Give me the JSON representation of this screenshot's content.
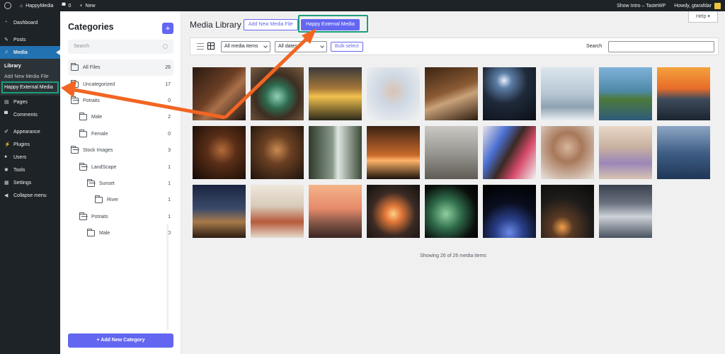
{
  "adminbar": {
    "site_name": "HappyMedia",
    "comments_count": "0",
    "new_label": "New",
    "show_intro": "Show Intro – TasteWP",
    "howdy": "Howdy, gtarafdar"
  },
  "adminmenu": {
    "items": [
      {
        "label": "Dashboard",
        "icon": "dashboard-icon"
      },
      {
        "label": "Posts",
        "icon": "pin-icon"
      },
      {
        "label": "Media",
        "icon": "media-icon"
      },
      {
        "label": "Pages",
        "icon": "page-icon"
      },
      {
        "label": "Comments",
        "icon": "comment-icon"
      },
      {
        "label": "Appearance",
        "icon": "brush-icon"
      },
      {
        "label": "Plugins",
        "icon": "plug-icon"
      },
      {
        "label": "Users",
        "icon": "user-icon"
      },
      {
        "label": "Tools",
        "icon": "wrench-icon"
      },
      {
        "label": "Settings",
        "icon": "settings-icon"
      },
      {
        "label": "Collapse menu",
        "icon": "collapse-icon"
      }
    ],
    "media_submenu": [
      "Library",
      "Add New Media File",
      "Happy External Media"
    ]
  },
  "categories": {
    "title": "Categories",
    "add_symbol": "+",
    "search_placeholder": "Search",
    "items": [
      {
        "label": "All Files",
        "count": "26"
      },
      {
        "label": "Uncategorized",
        "count": "17"
      },
      {
        "label": "Potraits",
        "count": "0"
      },
      {
        "label": "Male",
        "count": "2"
      },
      {
        "label": "Female",
        "count": "0"
      },
      {
        "label": "Stock Images",
        "count": "3"
      },
      {
        "label": "LandScape",
        "count": "1"
      },
      {
        "label": "Sunset",
        "count": "1"
      },
      {
        "label": "River",
        "count": "1"
      },
      {
        "label": "Potraits",
        "count": "1"
      },
      {
        "label": "Male",
        "count": "0"
      }
    ],
    "new_category_button": "+ Add New Category"
  },
  "main": {
    "title": "Media Library",
    "add_new_button": "Add New Media File",
    "external_button": "Happy External Media",
    "help": "Help ▾",
    "filter_type": "All media items",
    "filter_date": "All dates",
    "bulk_select": "Bulk select",
    "search_label": "Search",
    "search_value": "",
    "showing_text": "Showing 26 of 26 media items"
  },
  "colors": {
    "accent": "#6366f1",
    "wp_blue": "#2271b1",
    "highlight": "#1a9e7c",
    "arrow": "#f26522"
  },
  "thumbnails": [
    {
      "name": "woman-hand-face",
      "bg": "linear-gradient(135deg,#2a1a12 0%,#6b3f24 45%,#a8704a 60%,#1d120c 100%)"
    },
    {
      "name": "green-window",
      "bg": "radial-gradient(circle at 50% 55%,#8fd3b6 0%,#2e6b4f 30%,#3d2e22 55%,#7a5c42 100%)"
    },
    {
      "name": "sunflowers-storm",
      "bg": "linear-gradient(180deg,#3a3a3a 0%,#a5773a 40%,#f2c14e 55%,#2c2a1a 100%)"
    },
    {
      "name": "bunny-illustration",
      "bg": "radial-gradient(circle at 50% 45%,#d9c3b5 0%,#cfd9e4 40%,#f2f2f2 100%)"
    },
    {
      "name": "old-king",
      "bg": "linear-gradient(160deg,#3b2412 0%,#8a5a34 45%,#c9a27a 60%,#2e1c0f 100%)"
    },
    {
      "name": "moon-street",
      "bg": "radial-gradient(circle at 40% 25%,#e8f0ff 0%,#5c7ea6 15%,#1f2a3a 45%,#0b0f16 100%)"
    },
    {
      "name": "snow-city",
      "bg": "linear-gradient(180deg,#dbe6ee 0%,#b7c6d3 50%,#8ea2b2 75%,#e9eef2 100%)"
    },
    {
      "name": "coast-rock",
      "bg": "linear-gradient(180deg,#7fb2d9 0%,#4e8aa8 45%,#4d7a3a 60%,#2e5c7c 100%)"
    },
    {
      "name": "pier-sunset",
      "bg": "linear-gradient(180deg,#f4a23c 0%,#e86c2a 40%,#3e4b5c 60%,#1b2430 100%)"
    },
    {
      "name": "woman-shadow",
      "bg": "radial-gradient(circle at 55% 45%,#b36b3a 0%,#5a2e17 35%,#120a06 100%)"
    },
    {
      "name": "man-sunglasses",
      "bg": "radial-gradient(circle at 50% 45%,#c98a52 0%,#6b4022 35%,#1a120c 100%)"
    },
    {
      "name": "waterfall",
      "bg": "linear-gradient(90deg,#2f3a2c 0%,#8a9a8a 45%,#dfe6e2 55%,#3a4a35 100%)"
    },
    {
      "name": "orange-dusk",
      "bg": "linear-gradient(180deg,#3a2214 0%,#c96a2a 55%,#ffb46a 65%,#1c120b 100%)"
    },
    {
      "name": "foggy-beach",
      "bg": "linear-gradient(180deg,#c9c8c2 0%,#9a9892 50%,#5e5b54 100%)"
    },
    {
      "name": "man-painted-wall",
      "bg": "linear-gradient(120deg,#e8e2e8 0%,#4a6fd1 30%,#3a2a24 50%,#d64a6a 70%,#f2f2f2 100%)"
    },
    {
      "name": "woman-portrait",
      "bg": "radial-gradient(circle at 50% 40%,#d8b59a 0%,#a8785a 35%,#e9e4de 100%)"
    },
    {
      "name": "woman-purple-dress",
      "bg": "linear-gradient(180deg,#e9d8c7 0%,#c8b0a0 40%,#9b86b8 70%,#d8c4b2 100%)"
    },
    {
      "name": "blue-grass",
      "bg": "linear-gradient(180deg,#8ea6c4 0%,#3f5f86 50%,#1f3656 100%)"
    },
    {
      "name": "starry-desert",
      "bg": "linear-gradient(180deg,#1a2440 0%,#3b4a6a 45%,#a77a4a 70%,#2a1c12 100%)"
    },
    {
      "name": "kitchen-pots",
      "bg": "linear-gradient(180deg,#efe7dc 0%,#d8cbb8 40%,#b65a3a 70%,#e6ddd0 100%)"
    },
    {
      "name": "hazy-mountains",
      "bg": "linear-gradient(180deg,#f4b48a 0%,#e68a6a 45%,#8a5a4a 70%,#3a2622 100%)"
    },
    {
      "name": "mountain-sunrise",
      "bg": "radial-gradient(circle at 50% 55%,#ffd08a 0%,#e57a3a 20%,#3a2a24 55%,#12100e 100%)"
    },
    {
      "name": "green-planet",
      "bg": "radial-gradient(circle at 40% 55%,#8fcf9f 0%,#2f6b4a 35%,#0a0f0c 70%,#000 100%)"
    },
    {
      "name": "earth-space",
      "bg": "radial-gradient(circle at 50% 90%,#6a8ae6 0%,#2a3f8a 25%,#0a0e1e 55%,#000 100%)"
    },
    {
      "name": "person-night",
      "bg": "radial-gradient(circle at 40% 80%,#f2a04a 0%,#5a3a24 20%,#1e1c1a 55%,#0a0a0a 100%)"
    },
    {
      "name": "cloud-mountains",
      "bg": "linear-gradient(180deg,#3a4250 0%,#6a7280 35%,#cdd2d8 60%,#4a5260 100%)"
    }
  ]
}
